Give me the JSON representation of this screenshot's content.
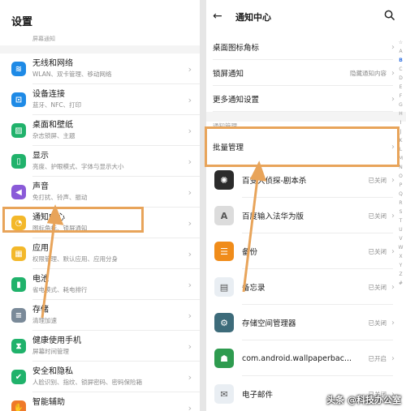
{
  "left": {
    "title": "设置",
    "partial_sub": "屏幕通知",
    "items": [
      {
        "title": "无线和网络",
        "desc": "WLAN、双卡管理、移动网络",
        "color": "#1e8ae6",
        "icon": "wifi-icon",
        "glyph": "≋"
      },
      {
        "title": "设备连接",
        "desc": "蓝牙、NFC、打印",
        "color": "#1e8ae6",
        "icon": "device-connect-icon",
        "glyph": "⊡"
      },
      {
        "title": "桌面和壁纸",
        "desc": "杂志锁屏、主题",
        "color": "#20b26b",
        "icon": "wallpaper-icon",
        "glyph": "▨"
      },
      {
        "title": "显示",
        "desc": "亮度、护眼模式、字体与显示大小",
        "color": "#20b26b",
        "icon": "display-icon",
        "glyph": "▯"
      },
      {
        "title": "声音",
        "desc": "免打扰、铃声、振动",
        "color": "#8a5ad8",
        "icon": "sound-icon",
        "glyph": "◀"
      },
      {
        "title": "通知中心",
        "desc": "图标角标、锁屏通知",
        "color": "#f3b82a",
        "icon": "bell-icon",
        "glyph": "◔"
      },
      {
        "title": "应用",
        "desc": "权限管理、默认应用、应用分身",
        "color": "#f3b82a",
        "icon": "apps-icon",
        "glyph": "▦"
      },
      {
        "title": "电池",
        "desc": "省电模式、耗电排行",
        "color": "#20b26b",
        "icon": "battery-icon",
        "glyph": "▮"
      },
      {
        "title": "存储",
        "desc": "清理加速",
        "color": "#7a8a99",
        "icon": "storage-icon",
        "glyph": "≡"
      },
      {
        "title": "健康使用手机",
        "desc": "屏幕时间管理",
        "color": "#20b26b",
        "icon": "hourglass-icon",
        "glyph": "⧗"
      },
      {
        "title": "安全和隐私",
        "desc": "人脸识别、指纹、锁屏密码、密码保险箱",
        "color": "#20b26b",
        "icon": "shield-icon",
        "glyph": "✔"
      },
      {
        "title": "智能辅助",
        "desc": "",
        "color": "#ef7a2a",
        "icon": "assist-icon",
        "glyph": "✋"
      }
    ]
  },
  "right": {
    "title": "通知中心",
    "rows": [
      {
        "label": "桌面图标角标",
        "value": ""
      },
      {
        "label": "锁屏通知",
        "value": "隐藏通知内容"
      },
      {
        "label": "更多通知设置",
        "value": ""
      }
    ],
    "section_cut": "通知管理",
    "batch_label": "批量管理",
    "apps": [
      {
        "name": "百变大侦探-剧本杀",
        "status": "已关闭",
        "color": "#2b2b2b",
        "icon": "detective-app-icon",
        "glyph": "✺"
      },
      {
        "name": "百度输入法华为版",
        "status": "已关闭",
        "color": "#dcdcdc",
        "icon": "input-method-app-icon",
        "glyph": "A"
      },
      {
        "name": "备份",
        "status": "已关闭",
        "color": "#f08c1a",
        "icon": "backup-app-icon",
        "glyph": "☰"
      },
      {
        "name": "备忘录",
        "status": "已关闭",
        "color": "#e9eef3",
        "icon": "memo-app-icon",
        "glyph": "▤"
      },
      {
        "name": "存储空间管理器",
        "status": "已关闭",
        "color": "#3d6b7a",
        "icon": "storage-manager-app-icon",
        "glyph": "⚙"
      },
      {
        "name": "com.android.wallpaperbac...",
        "status": "已开启",
        "color": "#2e9b4f",
        "icon": "android-app-icon",
        "glyph": "☗"
      },
      {
        "name": "电子邮件",
        "status": "已关闭",
        "color": "#e9eef3",
        "icon": "email-app-icon",
        "glyph": "✉"
      }
    ],
    "alphabet": [
      "☆",
      "A",
      "B",
      "C",
      "D",
      "E",
      "F",
      "G",
      "H",
      "I",
      "J",
      "K",
      "L",
      "M",
      "N",
      "O",
      "P",
      "Q",
      "R",
      "S",
      "T",
      "U",
      "V",
      "W",
      "X",
      "Y",
      "Z",
      "#"
    ],
    "alphabet_active": "B"
  },
  "watermark": "头条 @科技办公室",
  "highlight_color": "#e8a45a"
}
